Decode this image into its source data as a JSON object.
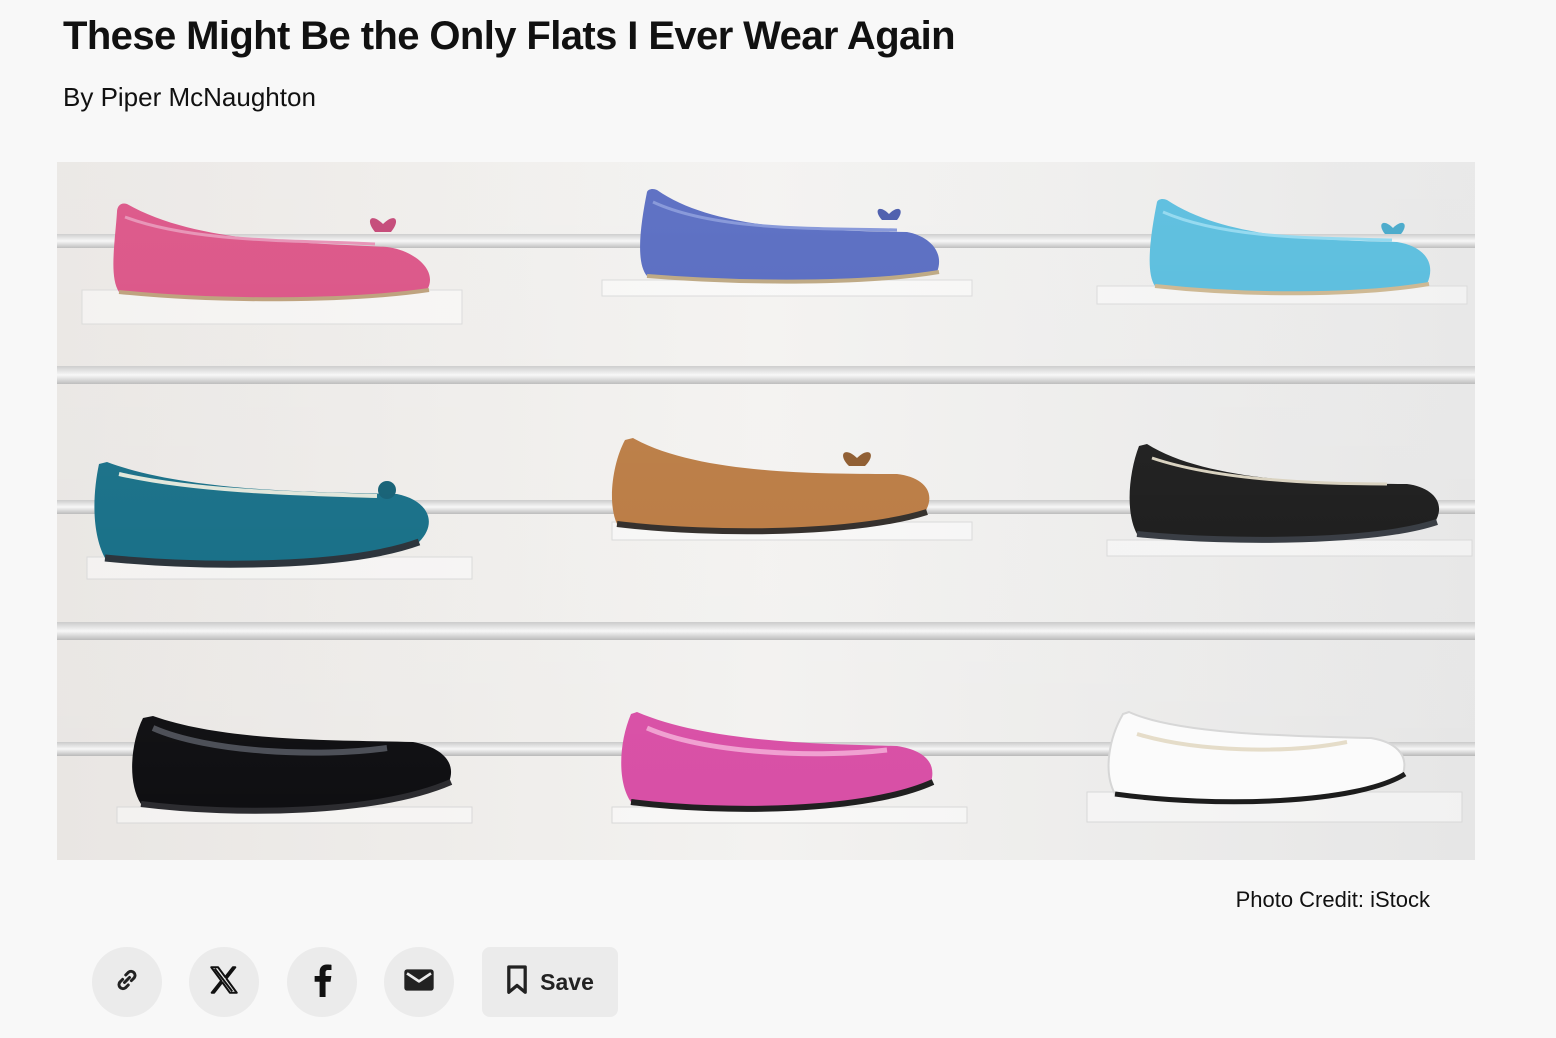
{
  "article": {
    "title": "These Might Be the Only Flats I Ever Wear Again",
    "byline": "By Piper McNaughton"
  },
  "hero_image": {
    "credit": "Photo Credit: iStock"
  },
  "share_bar": {
    "buttons": [
      {
        "icon": "link-icon"
      },
      {
        "icon": "x-icon"
      },
      {
        "icon": "facebook-icon"
      },
      {
        "icon": "email-icon"
      }
    ],
    "save_label": "Save"
  },
  "colors": {
    "page_background": "#f8f8f8",
    "button_background": "#ebebeb",
    "text": "#111111"
  }
}
